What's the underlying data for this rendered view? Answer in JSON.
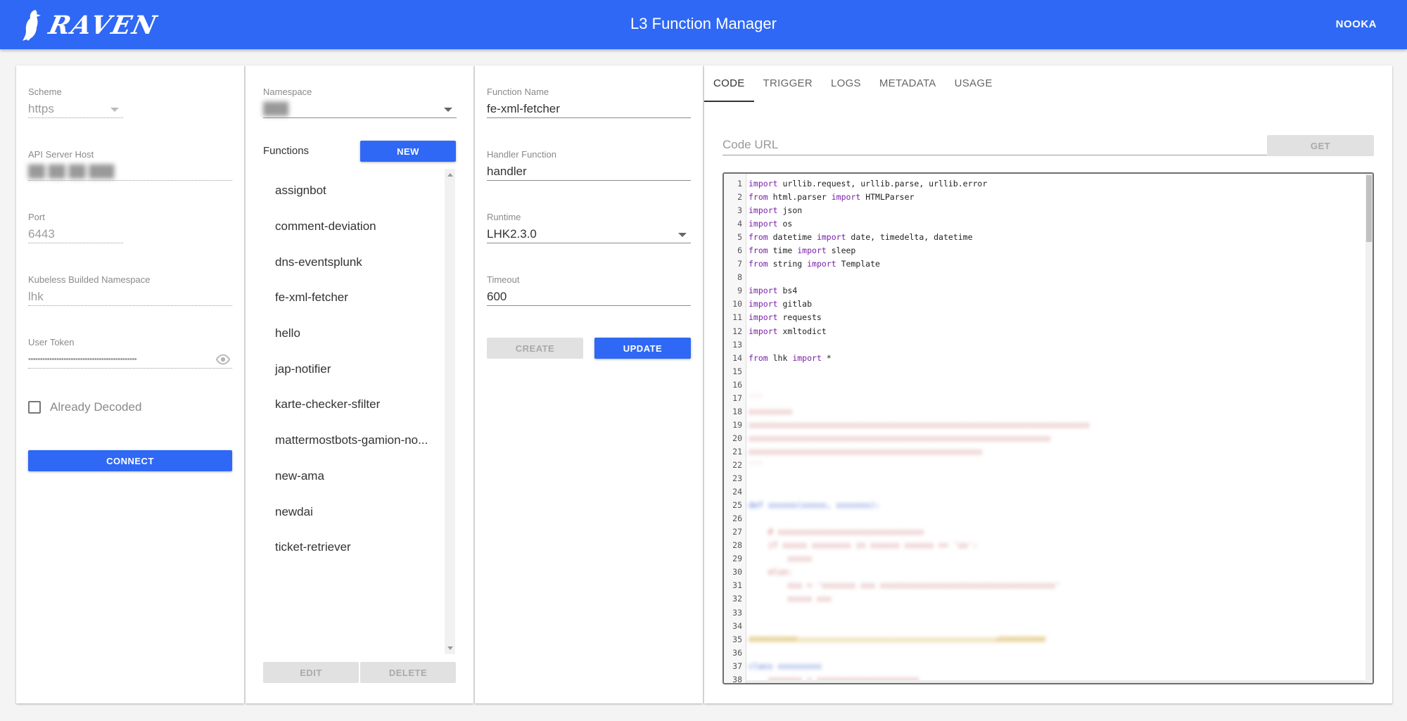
{
  "header": {
    "logo_text": "RAVEN",
    "title": "L3 Function Manager",
    "user": "NOOKA",
    "colors": {
      "primary": "#2f68f5"
    }
  },
  "connection": {
    "scheme_label": "Scheme",
    "scheme_value": "https",
    "api_host_label": "API Server Host",
    "port_label": "Port",
    "port_value": "6443",
    "namespace_label": "Kubeless Builded Namespace",
    "namespace_value": "lhk",
    "token_label": "User Token",
    "token_value": "••••••••••••••••••••••••••••••••••••••••••••••",
    "decoded_label": "Already Decoded",
    "connect_label": "CONNECT"
  },
  "functions_panel": {
    "namespace_label": "Namespace",
    "functions_label": "Functions",
    "new_label": "NEW",
    "items": [
      "assignbot",
      "comment-deviation",
      "dns-eventsplunk",
      "fe-xml-fetcher",
      "hello",
      "jap-notifier",
      "karte-checker-sfilter",
      "mattermostbots-gamion-no...",
      "new-ama",
      "newdai",
      "ticket-retriever"
    ],
    "edit_label": "EDIT",
    "delete_label": "DELETE"
  },
  "function_form": {
    "name_label": "Function Name",
    "name_value": "fe-xml-fetcher",
    "handler_label": "Handler Function",
    "handler_value": "handler",
    "runtime_label": "Runtime",
    "runtime_value": "LHK2.3.0",
    "timeout_label": "Timeout",
    "timeout_value": "600",
    "create_label": "CREATE",
    "update_label": "UPDATE"
  },
  "editor_panel": {
    "tabs": [
      "CODE",
      "TRIGGER",
      "LOGS",
      "METADATA",
      "USAGE"
    ],
    "active_tab": "CODE",
    "code_url_placeholder": "Code URL",
    "get_label": "GET",
    "code_lines": [
      "import urllib.request, urllib.parse, urllib.error",
      "from html.parser import HTMLParser",
      "import json",
      "import os",
      "from datetime import date, timedelta, datetime",
      "from time import sleep",
      "from string import Template",
      "",
      "import bs4",
      "import gitlab",
      "import requests",
      "import xmltodict",
      "",
      "from lhk import *",
      "",
      "",
      "",
      "",
      "",
      "",
      "",
      "",
      "",
      "",
      "",
      "",
      "",
      "",
      "",
      "",
      "",
      "",
      "",
      "",
      "",
      "",
      "",
      ""
    ]
  }
}
